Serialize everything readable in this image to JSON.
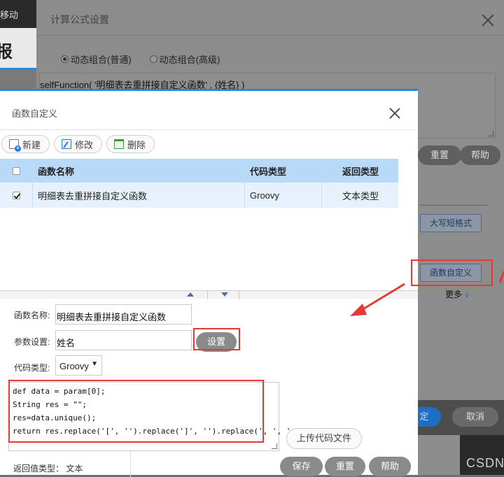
{
  "background": {
    "top_menu_label": "移动",
    "big_char": "报"
  },
  "outer_dialog": {
    "title": "计算公式设置",
    "radio_options": [
      {
        "label": "动态组合(普通)",
        "checked": true
      },
      {
        "label": "动态组合(高级)",
        "checked": false
      }
    ],
    "formula": "selfFunction( '明细表去重拼接自定义函数' , {姓名} )",
    "reset_label": "重置",
    "help_label": "帮助",
    "uppercase_label": "大写短格式",
    "custom_function_label": "函数自定义",
    "more_label": "更多",
    "confirm_label": "定",
    "cancel_label": "取消",
    "watermark": "CSDN"
  },
  "dialog": {
    "title": "函数自定义",
    "toolbar": {
      "new_label": "新建",
      "edit_label": "修改",
      "delete_label": "删除"
    },
    "table": {
      "headers": [
        "函数名称",
        "代码类型",
        "返回类型"
      ],
      "rows": [
        {
          "checked": true,
          "name": "明细表去重拼接自定义函数",
          "code_type": "Groovy",
          "return_type": "文本类型"
        }
      ]
    },
    "form": {
      "name_label": "函数名称:",
      "name_value": "明细表去重拼接自定义函数",
      "param_label": "参数设置:",
      "param_value": "姓名",
      "set_label": "设置",
      "code_type_label": "代码类型:",
      "code_type_value": "Groovy",
      "code": "def data = param[0];\nString res = \"\";\nres=data.unique();\nreturn res.replace('[', '').replace(']', '').replace(', ', '、').trim();",
      "upload_label": "上传代码文件",
      "return_type_label": "返回值类型：",
      "return_type_value": "文本",
      "save_label": "保存",
      "reset_label": "重置",
      "help_label": "帮助"
    }
  },
  "colors": {
    "accent": "#1e88e5",
    "highlight": "#e53935",
    "header_row": "#b8d9f7",
    "selected_row": "#e6f1fb"
  }
}
